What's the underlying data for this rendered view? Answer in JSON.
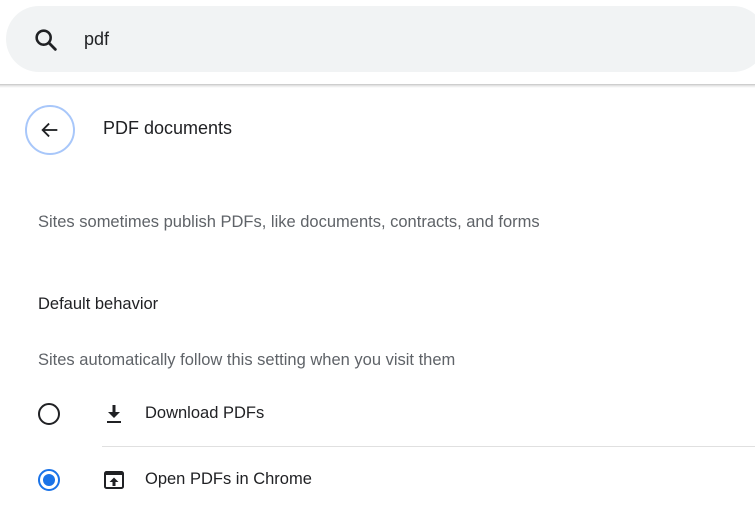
{
  "search": {
    "value": "pdf",
    "icon": "search-icon"
  },
  "header": {
    "title": "PDF documents",
    "back_icon": "arrow-back-icon"
  },
  "description": "Sites sometimes publish PDFs, like documents, contracts, and forms",
  "default_behavior": {
    "heading": "Default behavior",
    "subtitle": "Sites automatically follow this setting when you visit them",
    "options": [
      {
        "label": "Download PDFs",
        "icon": "download-icon",
        "selected": false
      },
      {
        "label": "Open PDFs in Chrome",
        "icon": "open-in-browser-icon",
        "selected": true
      }
    ]
  },
  "colors": {
    "accent": "#1a73e8",
    "search_background": "#f1f3f4",
    "back_button_border": "#a8c7fa",
    "secondary_text": "#5f6368"
  }
}
